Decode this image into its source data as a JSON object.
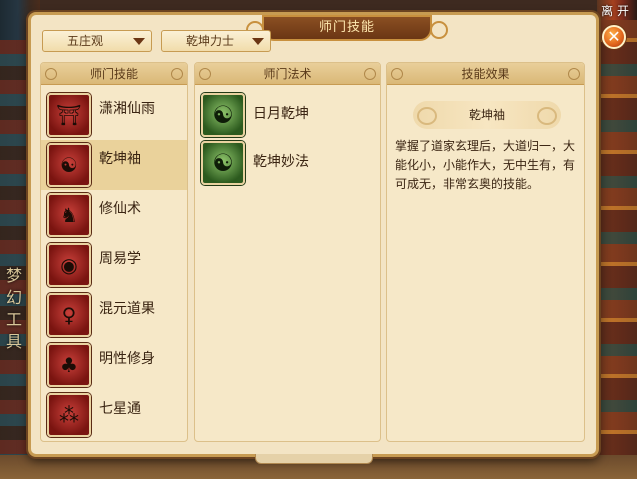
{
  "window": {
    "title": "师门技能",
    "exit_label": "离 开"
  },
  "side_glyphs": [
    "梦",
    "幻",
    "工",
    "具"
  ],
  "filters": {
    "school": "五庄观",
    "role": "乾坤力士"
  },
  "columns": {
    "skills_header": "师门技能",
    "methods_header": "师门法术",
    "effect_header": "技能效果"
  },
  "skills": [
    {
      "name": "潇湘仙雨",
      "icon": "pavilion-icon"
    },
    {
      "name": "乾坤袖",
      "icon": "yinyang-sleeve-icon",
      "selected": true
    },
    {
      "name": "修仙术",
      "icon": "immortal-figure-icon"
    },
    {
      "name": "周易学",
      "icon": "bagua-square-icon"
    },
    {
      "name": "混元道果",
      "icon": "gourd-icon"
    },
    {
      "name": "明性修身",
      "icon": "tree-icon"
    },
    {
      "name": "七星通",
      "icon": "seven-stars-icon"
    }
  ],
  "methods": [
    {
      "name": "日月乾坤",
      "icon": "yinyang-icon"
    },
    {
      "name": "乾坤妙法",
      "icon": "yinyang-icon"
    }
  ],
  "effect": {
    "title": "乾坤袖",
    "description": "掌握了道家玄理后，大道归一，大能化小，小能作大，无中生有，有可成无，非常玄奥的技能。"
  }
}
